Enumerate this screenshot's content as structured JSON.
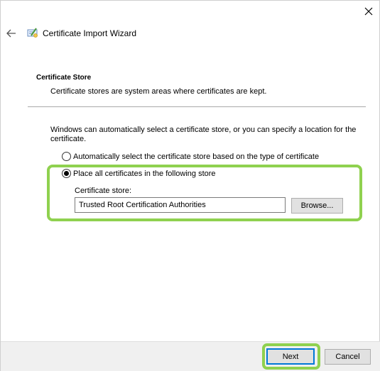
{
  "window": {
    "title": "Certificate Import Wizard",
    "close_icon": "close-icon",
    "back_icon": "back-arrow-icon",
    "app_icon": "certificate-icon"
  },
  "header": {
    "title": "Certificate Store",
    "description": "Certificate stores are system areas where certificates are kept."
  },
  "body": {
    "intro": "Windows can automatically select a certificate store, or you can specify a location for the certificate.",
    "options": [
      {
        "label": "Automatically select the certificate store based on the type of certificate",
        "checked": false
      },
      {
        "label": "Place all certificates in the following store",
        "checked": true
      }
    ],
    "store_label": "Certificate store:",
    "store_value": "Trusted Root Certification Authorities",
    "browse_label": "Browse..."
  },
  "footer": {
    "next_label": "Next",
    "cancel_label": "Cancel"
  },
  "colors": {
    "highlight": "#8fd14f",
    "focus": "#0078d7"
  }
}
